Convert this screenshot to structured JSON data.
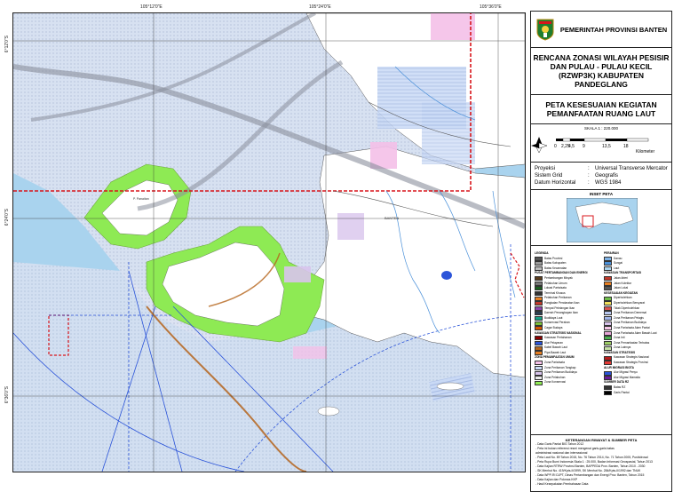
{
  "coords": {
    "top": [
      "105°12'0\"E",
      "105°24'0\"E",
      "105°36'0\"E"
    ],
    "left": [
      "6°12'0\"S",
      "6°24'0\"S",
      "6°36'0\"S"
    ]
  },
  "map_labels": {
    "banten": "BANTEN",
    "island_label": "P. Panaitan"
  },
  "header": {
    "government": "PEMERINTAH PROVINSI BANTEN",
    "title": "RENCANA ZONASI WILAYAH PESISIR DAN PULAU - PULAU KECIL (RZWP3K) KABUPATEN PANDEGLANG",
    "subtitle": "PETA KESESUAIAN KEGIATAN PEMANFAATAN RUANG LAUT"
  },
  "scale": {
    "label": "SKALA 1 : 220.000",
    "ticks": [
      "0",
      "2,25",
      "4,5",
      "9",
      "13,5",
      "18"
    ],
    "unit": "Kilometer"
  },
  "projection": [
    {
      "key": "Proyeksi",
      "value": "Universal Transverse Mercator"
    },
    {
      "key": "Sistem Grid",
      "value": "Geografis"
    },
    {
      "key": "Datum Horizontal",
      "value": "WGS 1984"
    }
  ],
  "inset": {
    "heading": "INSET PETA"
  },
  "legend": {
    "left_col": [
      {
        "text": "LEGENDA",
        "bold": true
      },
      {
        "text": "Batas Provinsi",
        "color": "#555"
      },
      {
        "text": "Batas Kabupaten",
        "color": "#999"
      },
      {
        "text": "Batas Kecamatan",
        "color": "#bbb"
      },
      {
        "text": "PUSAT PERTAMBANGAN DAN ENERGI",
        "bold": true
      },
      {
        "text": "Pertambangan Minyak",
        "color": "#5a3d1e"
      },
      {
        "text": "Pelabuhan Umum",
        "color": "#777"
      },
      {
        "text": "Lokasi Pariwisata",
        "color": "#1b5e20"
      },
      {
        "text": "Terminal Khusus",
        "color": "#333"
      },
      {
        "text": "Pelabuhan Perikanan",
        "color": "#e67e22"
      },
      {
        "text": "Pangkalan Pendaratan Ikan",
        "color": "#c0392b"
      },
      {
        "text": "Tempat Pelelangan Ikan",
        "color": "#8e44ad"
      },
      {
        "text": "Daerah Penangkapan Ikan",
        "color": "#2c3e50"
      },
      {
        "text": "Budidaya Laut",
        "color": "#16a085"
      },
      {
        "text": "Konservasi Perairan",
        "color": "#7cbf3a"
      },
      {
        "text": "Cagar Budaya",
        "color": "#d35400"
      },
      {
        "text": "KAWASAN STRATEGIS NASIONAL",
        "bold": true
      },
      {
        "text": "Kawasan Pertahanan",
        "color": "#8b0000"
      },
      {
        "text": "Alur Pelayaran",
        "color": "#2b54d9"
      },
      {
        "text": "Kabel Bawah Laut",
        "color": "#b5651d"
      },
      {
        "text": "Pipa Bawah Laut",
        "color": "#e67e22"
      },
      {
        "text": "ZONA PEMANFAATAN UMUM",
        "bold": true
      },
      {
        "text": "Zona Pariwisata",
        "color": "#f4c0e8"
      },
      {
        "text": "Zona Perikanan Tangkap",
        "color": "#c9d9f5"
      },
      {
        "text": "Zona Perikanan Budidaya",
        "color": "#d8c4ec"
      },
      {
        "text": "Zona Pelabuhan",
        "color": "#eaeaea"
      },
      {
        "text": "Zona Konservasi",
        "color": "#8eea54"
      }
    ],
    "right_col": [
      {
        "text": "PERAIRAN",
        "bold": true
      },
      {
        "text": "Danau",
        "color": "#7fb2e5"
      },
      {
        "text": "Sungai",
        "color": "#4a90d9"
      },
      {
        "text": "Laut",
        "color": "#a9d3ee"
      },
      {
        "text": "KAWASAN TRANSPORTASI",
        "bold": true
      },
      {
        "text": "Jalan Arteri",
        "color": "#c0392b"
      },
      {
        "text": "Jalan Kolektor",
        "color": "#e67e22"
      },
      {
        "text": "Jalan Lokal",
        "color": "#555"
      },
      {
        "text": "KESESUAIAN KEGIATAN",
        "bold": true
      },
      {
        "text": "Diperbolehkan",
        "color": "#6fbf4a"
      },
      {
        "text": "Diperbolehkan Bersyarat",
        "color": "#f1e05a"
      },
      {
        "text": "Tidak Diperbolehkan",
        "color": "#d9534f"
      },
      {
        "text": "Zona Perikanan Demersal",
        "color": "#b8c8f0"
      },
      {
        "text": "Zona Perikanan Pelagis",
        "color": "#9fb3e8"
      },
      {
        "text": "Zona Perikanan Budidaya",
        "color": "#d8c4ec"
      },
      {
        "text": "Zona Pariwisata Alam Pantai",
        "color": "#f6c7e8"
      },
      {
        "text": "Zona Pariwisata Alam Bawah Laut",
        "color": "#e8a6d8"
      },
      {
        "text": "Zona Inti",
        "color": "#4caf50"
      },
      {
        "text": "Zona Pemanfaatan Terbatas",
        "color": "#9ccc65"
      },
      {
        "text": "Zona Lainnya",
        "color": "#c5e1a5"
      },
      {
        "text": "KAWASAN STRATEGIS",
        "bold": true
      },
      {
        "text": "Kawasan Strategis Nasional",
        "color": "#b71c1c"
      },
      {
        "text": "Kawasan Strategis Provinsi",
        "color": "#e53935"
      },
      {
        "text": "ALUR MIGRASI BIOTA",
        "bold": true
      },
      {
        "text": "Alur Migrasi Penyu",
        "color": "#2b54d9"
      },
      {
        "text": "Alur Migrasi Mamalia",
        "color": "#6a1b9a"
      },
      {
        "text": "SUMBER DATA RZ",
        "bold": true
      },
      {
        "text": "Batas RZ",
        "color": "#333"
      },
      {
        "text": "Garis Pantai",
        "color": "#000"
      }
    ]
  },
  "sources": {
    "heading": "KETERANGAN RIWAYAT & SUMBER PETA",
    "lines": [
      "- Data Garis Pantai BIG Tahun 2012",
      "- Peta ini bukan referensi resmi mengenai garis-garis batas",
      "  administrasi nasional dan internasional",
      "- Peta Laut No. 89 Tahun 2015, No. 76 Tahun 2014, No. 71 Tahun 2005, Pushidrosal",
      "- Peta Rupa Bumi Indonesia Skala 1 : 25.000, Badan Informasi Geospasial, Tahun 2013",
      "- Data Kajian RTRW Provinsi Banten, BAPPEDA Prov. Banten, Tahun 2010 - 2030",
      "- SK Menhut No. 419/Kpts-II/1999, SK Menhut No. 284/Kpts-II/1992 dan TNUK",
      "- Data WPP-RI DJPT, Dinas Pertambangan dan Energi Prov. Banten, Tahun 2015",
      "- Data Kajian dan Pokmas KKP",
      "- Hasil Kesepakatan Pembahasan Data"
    ]
  },
  "colors": {
    "sea": "#a9d3ee",
    "land": "#ffffff",
    "conservation": "#8eea54",
    "tourism": "#f4c0e8",
    "border_red": "#d9151b",
    "shipping_lane": "#2b54d9"
  }
}
